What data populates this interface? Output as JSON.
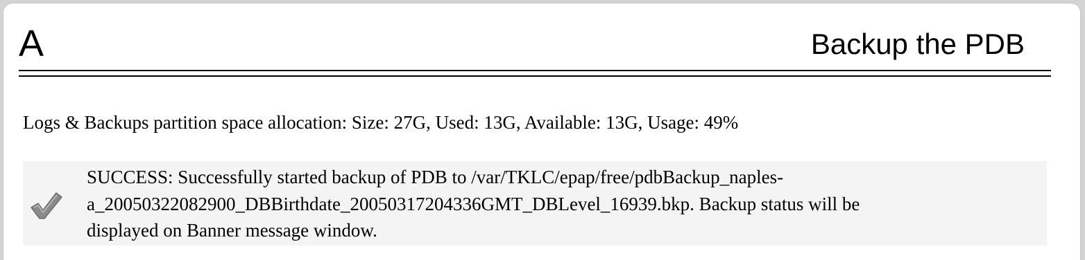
{
  "header": {
    "letter": "A",
    "title": "Backup the PDB"
  },
  "partition": {
    "info": "Logs & Backups partition space allocation: Size: 27G, Used: 13G, Available: 13G, Usage: 49%"
  },
  "message": {
    "icon": "checkmark-icon",
    "text": "SUCCESS: Successfully started backup of PDB to /var/TKLC/epap/free/pdbBackup_naples-\na_20050322082900_DBBirthdate_20050317204336GMT_DBLevel_16939.bkp. Backup status will be\ndisplayed on Banner message window."
  },
  "colors": {
    "page_background": "#d4d4d4",
    "panel_background": "#ffffff",
    "message_background": "#f4f4f4",
    "checkmark": "#8a8a8a"
  }
}
